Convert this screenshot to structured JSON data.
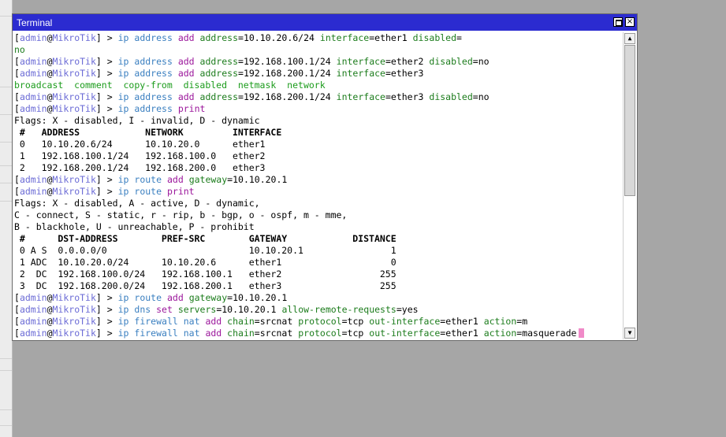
{
  "window": {
    "title": "Terminal",
    "maximize_label": "",
    "close_label": "×"
  },
  "prompt": {
    "user": "admin",
    "host": "MikroTik"
  },
  "scrollbar": {
    "up_label": "▲",
    "down_label": "▼"
  },
  "lines": [
    {
      "type": "cmd",
      "words": [
        [
          "ip",
          "m"
        ],
        [
          "address",
          "s"
        ],
        [
          "add",
          "c"
        ]
      ],
      "params": [
        [
          "address",
          "10.10.20.6/24"
        ],
        [
          "interface",
          "ether1"
        ],
        [
          "disabled",
          ""
        ]
      ]
    },
    {
      "type": "text",
      "cls": "k",
      "text": "no"
    },
    {
      "type": "cmd",
      "words": [
        [
          "ip",
          "m"
        ],
        [
          "address",
          "s"
        ],
        [
          "add",
          "c"
        ]
      ],
      "params": [
        [
          "address",
          "192.168.100.1/24"
        ],
        [
          "interface",
          "ether2"
        ],
        [
          "disabled",
          "no"
        ]
      ]
    },
    {
      "type": "cmd",
      "words": [
        [
          "ip",
          "m"
        ],
        [
          "address",
          "s"
        ],
        [
          "add",
          "c"
        ]
      ],
      "params": [
        [
          "address",
          "192.168.200.1/24"
        ],
        [
          "interface",
          "ether3"
        ]
      ]
    },
    {
      "type": "text",
      "cls": "g",
      "text": "broadcast  comment  copy-from  disabled  netmask  network"
    },
    {
      "type": "cmd",
      "words": [
        [
          "ip",
          "m"
        ],
        [
          "address",
          "s"
        ],
        [
          "add",
          "c"
        ]
      ],
      "params": [
        [
          "address",
          "192.168.200.1/24"
        ],
        [
          "interface",
          "ether3"
        ],
        [
          "disabled",
          "no"
        ]
      ]
    },
    {
      "type": "cmd",
      "words": [
        [
          "ip",
          "m"
        ],
        [
          "address",
          "s"
        ],
        [
          "print",
          "c"
        ]
      ],
      "params": []
    },
    {
      "type": "text",
      "cls": "",
      "text": "Flags: X - disabled, I - invalid, D - dynamic"
    },
    {
      "type": "text",
      "cls": "",
      "bold": true,
      "text": " #   ADDRESS            NETWORK         INTERFACE"
    },
    {
      "type": "text",
      "cls": "",
      "text": " 0   10.10.20.6/24      10.10.20.0      ether1"
    },
    {
      "type": "text",
      "cls": "",
      "text": " 1   192.168.100.1/24   192.168.100.0   ether2"
    },
    {
      "type": "text",
      "cls": "",
      "text": " 2   192.168.200.1/24   192.168.200.0   ether3"
    },
    {
      "type": "cmd",
      "words": [
        [
          "ip",
          "m"
        ],
        [
          "route",
          "s"
        ],
        [
          "add",
          "c"
        ]
      ],
      "params": [
        [
          "gateway",
          "10.10.20.1"
        ]
      ]
    },
    {
      "type": "cmd",
      "words": [
        [
          "ip",
          "m"
        ],
        [
          "route",
          "s"
        ],
        [
          "print",
          "c"
        ]
      ],
      "params": []
    },
    {
      "type": "text",
      "cls": "",
      "text": "Flags: X - disabled, A - active, D - dynamic,"
    },
    {
      "type": "text",
      "cls": "",
      "text": "C - connect, S - static, r - rip, b - bgp, o - ospf, m - mme,"
    },
    {
      "type": "text",
      "cls": "",
      "text": "B - blackhole, U - unreachable, P - prohibit"
    },
    {
      "type": "text",
      "cls": "",
      "bold": true,
      "text": " #      DST-ADDRESS        PREF-SRC        GATEWAY            DISTANCE"
    },
    {
      "type": "text",
      "cls": "",
      "text": " 0 A S  0.0.0.0/0                          10.10.20.1                1"
    },
    {
      "type": "text",
      "cls": "",
      "text": " 1 ADC  10.10.20.0/24      10.10.20.6      ether1                    0"
    },
    {
      "type": "text",
      "cls": "",
      "text": " 2  DC  192.168.100.0/24   192.168.100.1   ether2                  255"
    },
    {
      "type": "text",
      "cls": "",
      "text": " 3  DC  192.168.200.0/24   192.168.200.1   ether3                  255"
    },
    {
      "type": "cmd",
      "words": [
        [
          "ip",
          "m"
        ],
        [
          "route",
          "s"
        ],
        [
          "add",
          "c"
        ]
      ],
      "params": [
        [
          "gateway",
          "10.10.20.1"
        ]
      ]
    },
    {
      "type": "cmd",
      "words": [
        [
          "ip",
          "m"
        ],
        [
          "dns",
          "s"
        ],
        [
          "set",
          "c"
        ]
      ],
      "params": [
        [
          "servers",
          "10.10.20.1"
        ],
        [
          "allow-remote-requests",
          "yes"
        ]
      ]
    },
    {
      "type": "cmd",
      "words": [
        [
          "ip",
          "m"
        ],
        [
          "firewall",
          "s"
        ],
        [
          "nat",
          "s"
        ],
        [
          "add",
          "c"
        ]
      ],
      "params": [
        [
          "chain",
          "srcnat"
        ],
        [
          "protocol",
          "tcp"
        ],
        [
          "out-interface",
          "ether1"
        ],
        [
          "action",
          "m"
        ]
      ]
    },
    {
      "type": "cmd",
      "cursor": true,
      "words": [
        [
          "ip",
          "m"
        ],
        [
          "firewall",
          "s"
        ],
        [
          "nat",
          "s"
        ],
        [
          "add",
          "c"
        ]
      ],
      "params": [
        [
          "chain",
          "srcnat"
        ],
        [
          "protocol",
          "tcp"
        ],
        [
          "out-interface",
          "ether1"
        ],
        [
          "action",
          "masquerade"
        ]
      ]
    }
  ]
}
